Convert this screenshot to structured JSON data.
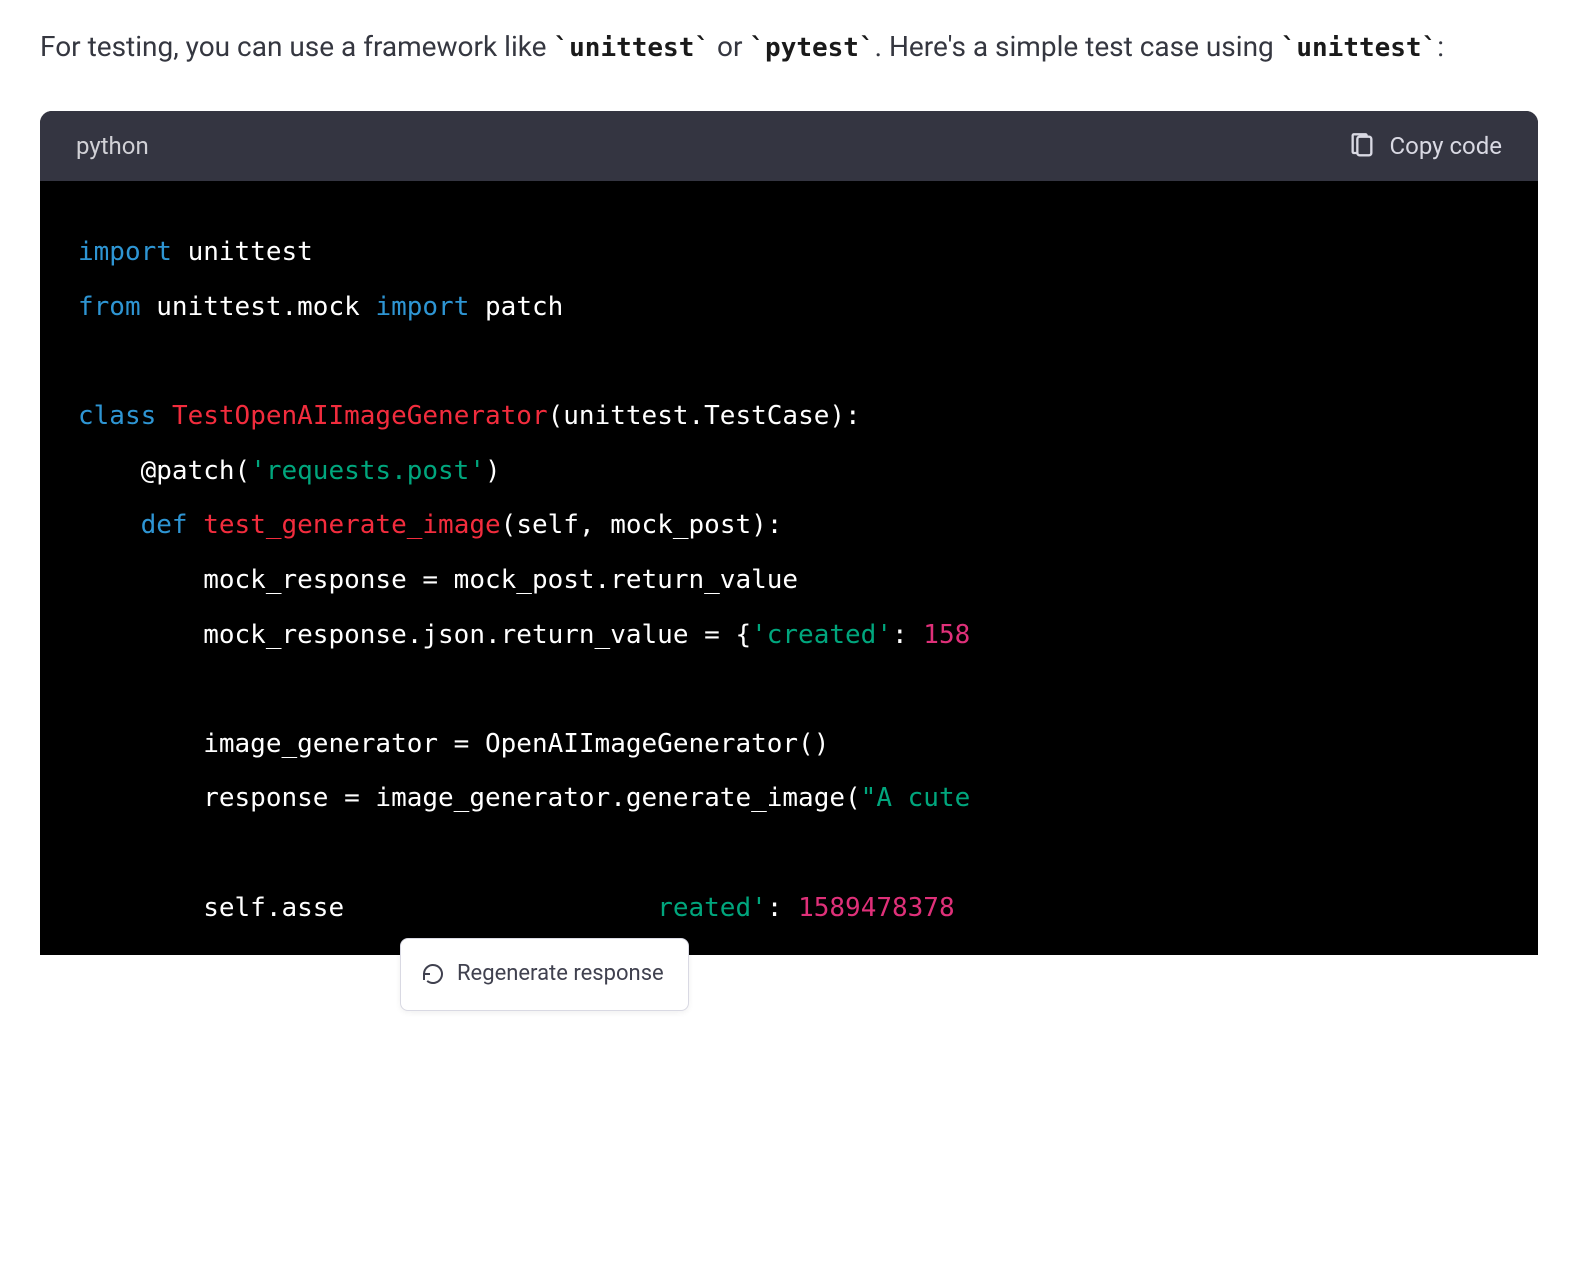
{
  "prose": {
    "segments": [
      {
        "text": "For testing, you can use a framework like ",
        "type": "plain"
      },
      {
        "text": "`unittest`",
        "type": "code"
      },
      {
        "text": " or ",
        "type": "plain"
      },
      {
        "text": "`pytest`",
        "type": "code"
      },
      {
        "text": ". Here's a simple test case using ",
        "type": "plain"
      },
      {
        "text": "`unittest`",
        "type": "code"
      },
      {
        "text": ":",
        "type": "plain"
      }
    ]
  },
  "code_block": {
    "language": "python",
    "copy_label": "Copy code",
    "tokens": [
      [
        {
          "t": "import",
          "c": "keyword"
        },
        {
          "t": " unittest",
          "c": "default"
        }
      ],
      [
        {
          "t": "from",
          "c": "keyword"
        },
        {
          "t": " unittest.mock ",
          "c": "default"
        },
        {
          "t": "import",
          "c": "keyword"
        },
        {
          "t": " patch",
          "c": "default"
        }
      ],
      [],
      [
        {
          "t": "class",
          "c": "keyword"
        },
        {
          "t": " ",
          "c": "default"
        },
        {
          "t": "TestOpenAIImageGenerator",
          "c": "class"
        },
        {
          "t": "(unittest.TestCase):",
          "c": "default"
        }
      ],
      [
        {
          "t": "    @patch(",
          "c": "default"
        },
        {
          "t": "'requests.post'",
          "c": "string"
        },
        {
          "t": ")",
          "c": "default"
        }
      ],
      [
        {
          "t": "    ",
          "c": "default"
        },
        {
          "t": "def",
          "c": "keyword"
        },
        {
          "t": " ",
          "c": "default"
        },
        {
          "t": "test_generate_image",
          "c": "func"
        },
        {
          "t": "(self, mock_post):",
          "c": "default"
        }
      ],
      [
        {
          "t": "        mock_response = mock_post.return_value",
          "c": "default"
        }
      ],
      [
        {
          "t": "        mock_response.json.return_value = {",
          "c": "default"
        },
        {
          "t": "'created'",
          "c": "string"
        },
        {
          "t": ": ",
          "c": "default"
        },
        {
          "t": "158",
          "c": "number"
        }
      ],
      [],
      [
        {
          "t": "        image_generator = OpenAIImageGenerator()",
          "c": "default"
        }
      ],
      [
        {
          "t": "        response = image_generator.generate_image(",
          "c": "default"
        },
        {
          "t": "\"A cute",
          "c": "string"
        }
      ],
      [],
      [
        {
          "t": "        self.asse",
          "c": "default"
        },
        {
          "t": "                    ",
          "c": "default"
        },
        {
          "t": "reated'",
          "c": "string"
        },
        {
          "t": ": ",
          "c": "default"
        },
        {
          "t": "1589478378",
          "c": "number"
        }
      ]
    ]
  },
  "regenerate": {
    "label": "Regenerate response"
  }
}
